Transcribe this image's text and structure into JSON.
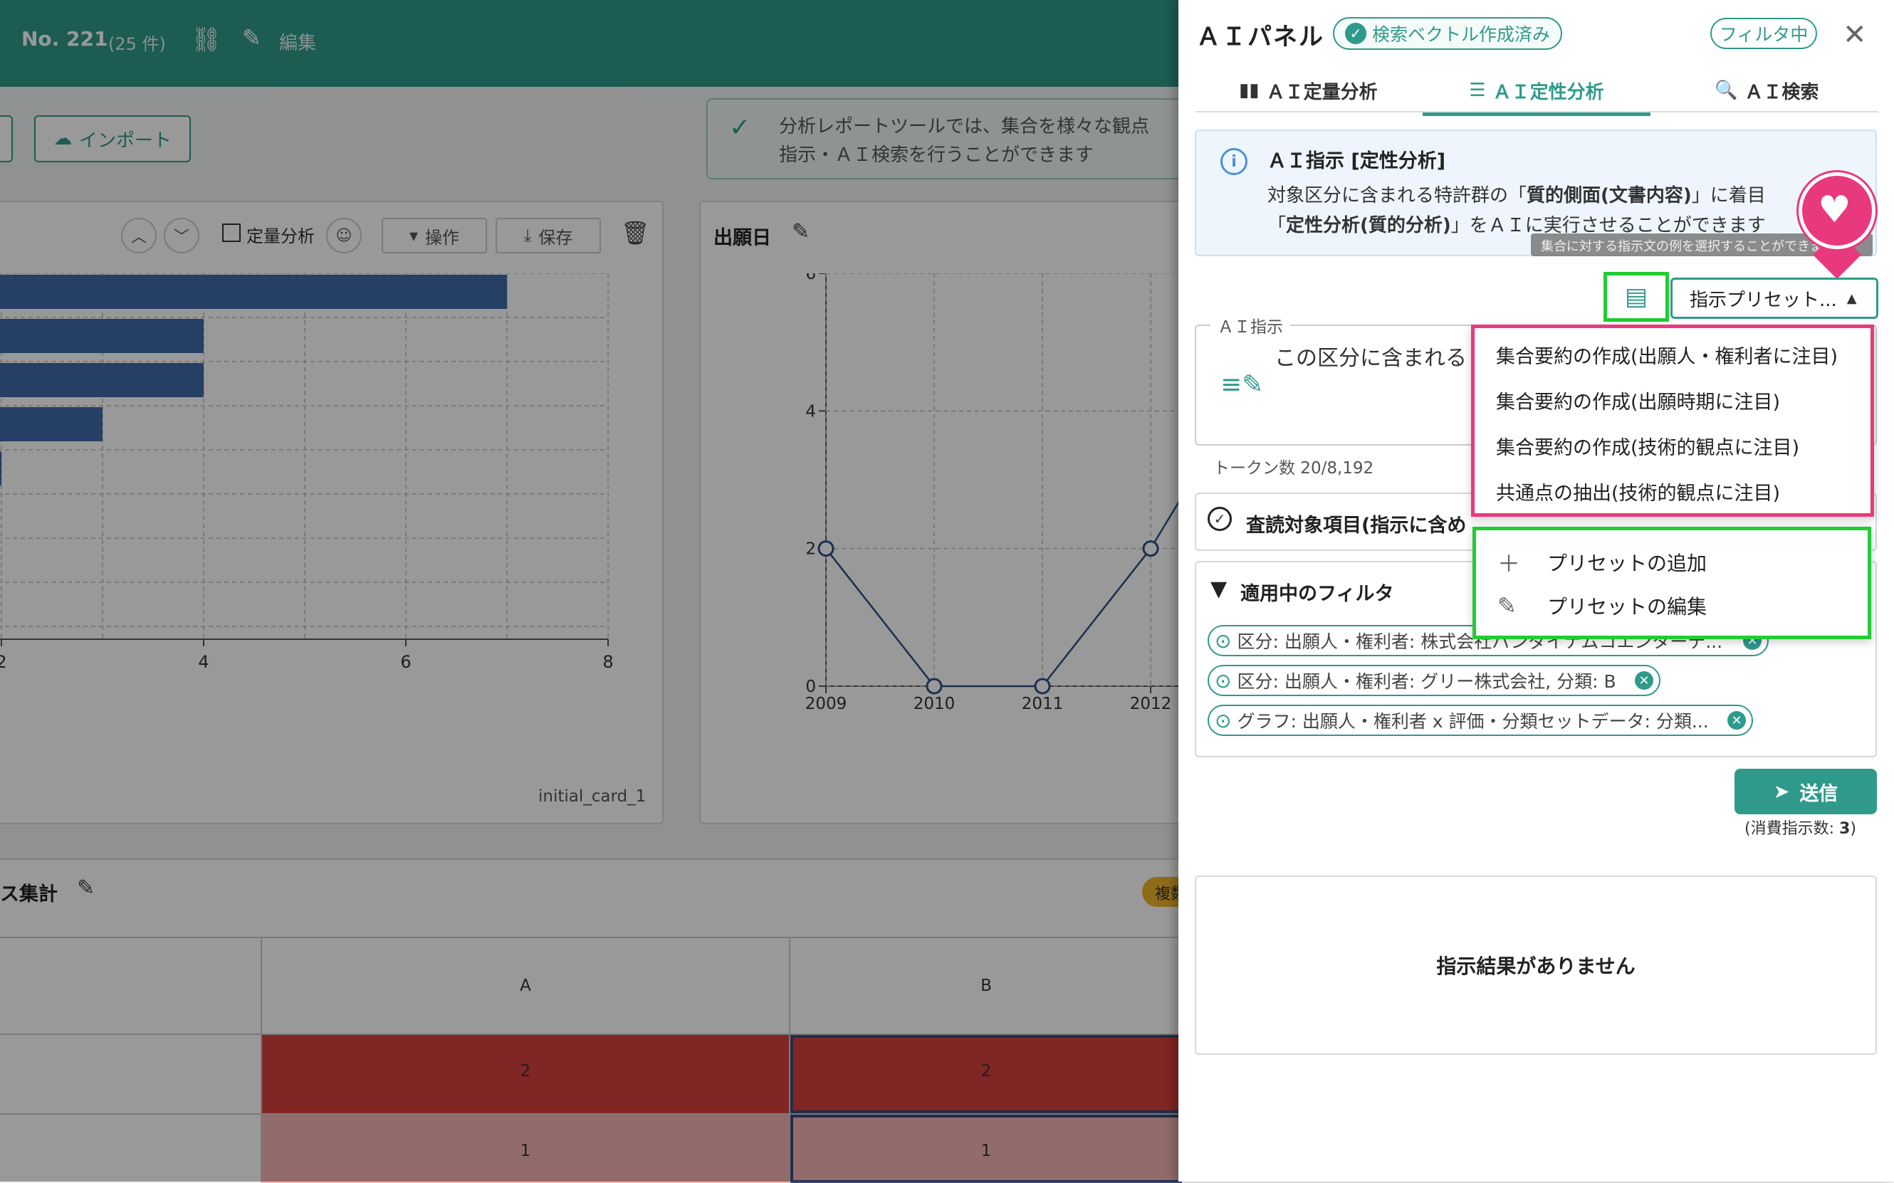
{
  "header": {
    "no_label": "No. 221",
    "count_label": "(25 件)",
    "edit_label": "編集"
  },
  "toolbar": {
    "import_label": "インポート"
  },
  "info_banner": {
    "line1": "分析レポートツールでは、集合を様々な観点",
    "line2": "指示・ＡＩ検索を行うことができます"
  },
  "card1": {
    "quant_label": "定量分析",
    "operate_label": "操作",
    "save_label": "保存",
    "footer": "initial_card_1",
    "x_ticks": [
      "2",
      "4",
      "6",
      "8"
    ]
  },
  "card2": {
    "title": "出願日"
  },
  "chart_data": [
    {
      "type": "bar",
      "orientation": "horizontal",
      "values": [
        7,
        4,
        4,
        3,
        2
      ],
      "xlim": [
        2,
        8
      ],
      "x_ticks": [
        "2",
        "4",
        "6",
        "8"
      ]
    },
    {
      "type": "line",
      "title": "出願日",
      "x": [
        "2009",
        "2010",
        "2011",
        "2012"
      ],
      "values": [
        2,
        0,
        0,
        2
      ],
      "ylim": [
        0,
        6
      ],
      "y_ticks": [
        "0",
        "2",
        "4",
        "6"
      ]
    }
  ],
  "bottom": {
    "title": "ス集計",
    "badge": "複数",
    "columns": [
      "A",
      "B"
    ],
    "rows": [
      [
        "2",
        "2"
      ],
      [
        "1",
        "1"
      ]
    ]
  },
  "panel": {
    "title": "ＡＩパネル",
    "vector_badge": "検索ベクトル作成済み",
    "filter_pill": "フィルタ中",
    "tabs": [
      "ＡＩ定量分析",
      "ＡＩ定性分析",
      "ＡＩ検索"
    ],
    "info_heading": "ＡＩ指示 [定性分析]",
    "info_line1_a": "対象区分に含まれる特許群の「",
    "info_line1_b": "質的側面(文書内容)",
    "info_line1_c": "」に着目",
    "info_line2_a": "「",
    "info_line2_b": "定性分析(質的分析)",
    "info_line2_c": "」をＡＩに実行させることができます",
    "tooltip": "集合に対する指示文の例を選択することができます",
    "preset_select": "指示プリセット...",
    "instruction_legend": "ＡＩ指示",
    "instruction_text": "この区分に含まれる",
    "tokens": "トークン数 20/8,192",
    "review_title": "査読対象項目(指示に含め",
    "filters_title": "適用中のフィルタ",
    "filter_chips": [
      "区分: 出願人・権利者: 株式会社バンダイナムコエンターテ...",
      "区分: 出願人・権利者: グリー株式会社, 分類: B",
      "グラフ: 出願人・権利者 x 評価・分類セットデータ: 分類..."
    ],
    "send_label": "送信",
    "consumed_label": "(消費指示数: ",
    "consumed_value": "3",
    "consumed_close": ")",
    "no_result": "指示結果がありません"
  },
  "preset_menu": {
    "items": [
      "集合要約の作成(出願人・権利者に注目)",
      "集合要約の作成(出願時期に注目)",
      "集合要約の作成(技術的観点に注目)",
      "共通点の抽出(技術的観点に注目)"
    ],
    "add_label": "プリセットの追加",
    "edit_label": "プリセットの編集"
  },
  "colors": {
    "accent": "#2f9a8b",
    "highlight_pink": "#e8397e",
    "highlight_green": "#22cc33",
    "bar": "#3f6aa8"
  }
}
